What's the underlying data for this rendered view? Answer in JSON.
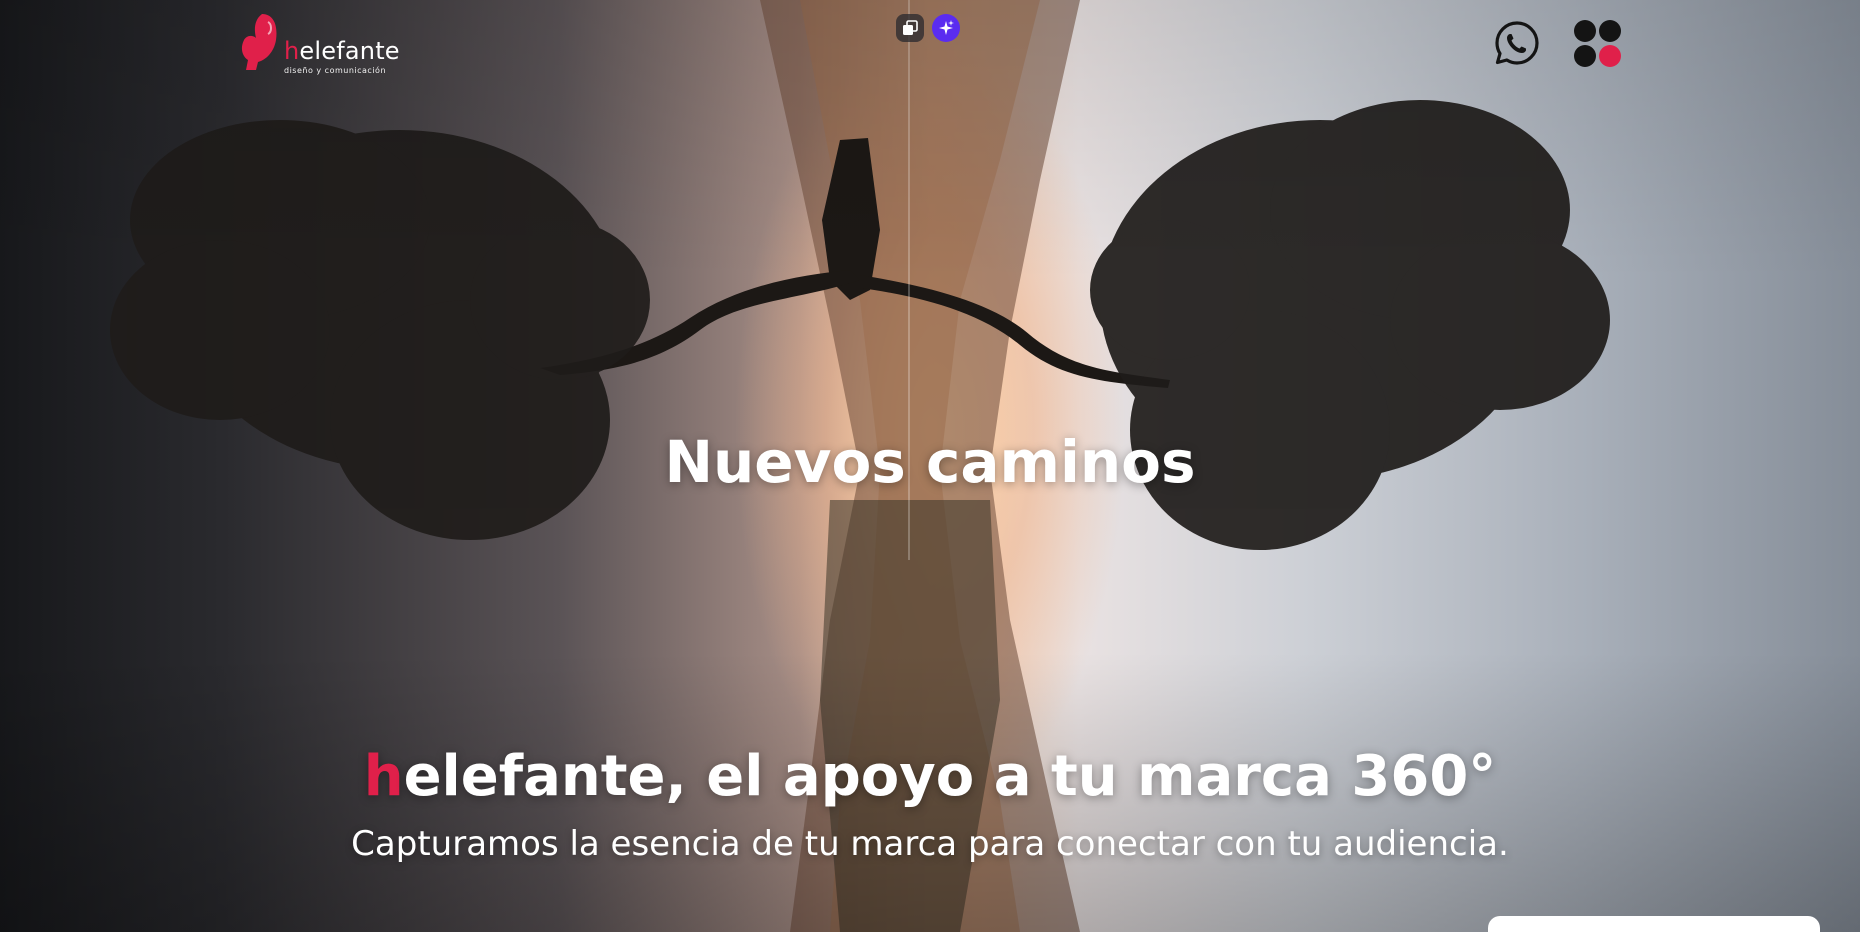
{
  "header": {
    "logo": {
      "accent_letter": "h",
      "name_rest": "elefante",
      "tagline": "diseño y comunicación",
      "icon": "elephant-logo-icon"
    },
    "tools": {
      "copy_icon": "copy-window-icon",
      "ai_icon": "sparkles-icon"
    },
    "whatsapp_icon": "whatsapp-icon",
    "menu_icon": "dots-grid-menu-icon"
  },
  "hero": {
    "title": "Nuevos caminos",
    "heading_accent": "h",
    "heading_rest": "elefante, el apoyo a tu marca 360°",
    "subheading": "Capturamos la esencia de tu marca para conectar con tu audiencia."
  },
  "colors": {
    "brand_red": "#e0204a",
    "ai_button": "#5a2cf0",
    "text": "#ffffff",
    "menu_dot": "#141414"
  }
}
